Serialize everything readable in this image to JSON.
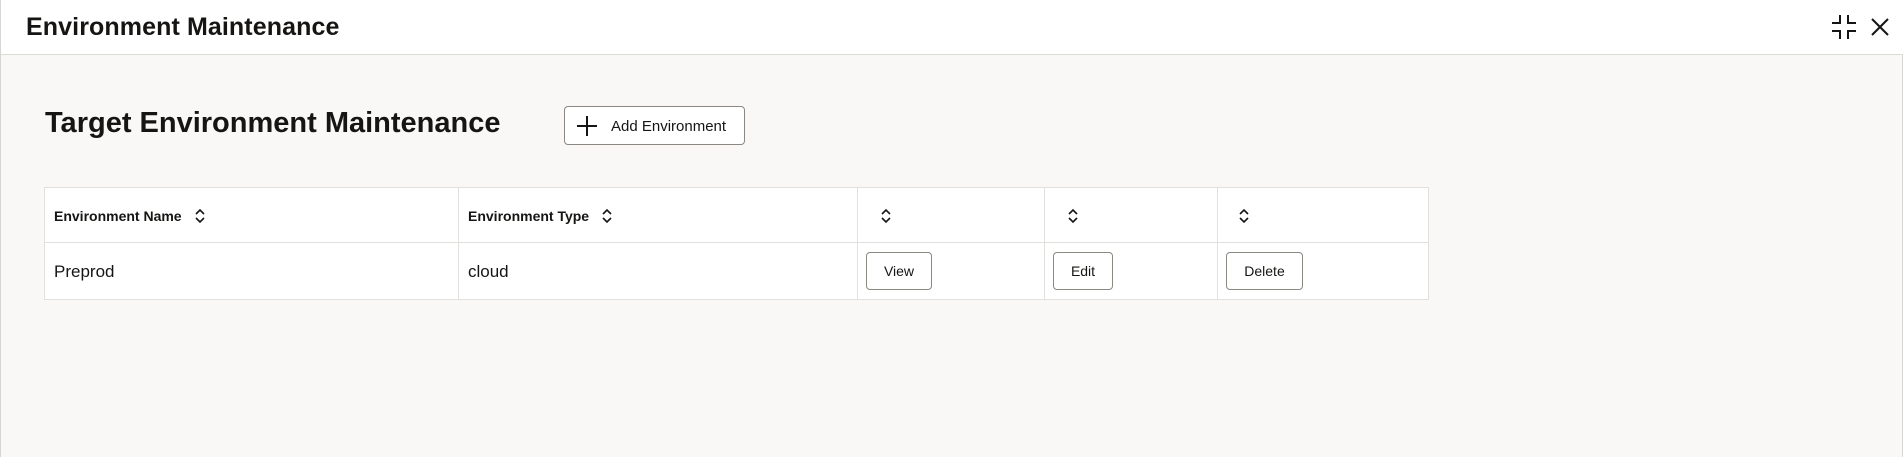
{
  "window": {
    "title": "Environment Maintenance",
    "collapse_icon": "collapse-icon",
    "close_icon": "close-icon"
  },
  "page": {
    "heading": "Target Environment Maintenance",
    "add_button_label": "Add Environment",
    "add_button_icon": "plus-icon"
  },
  "table": {
    "columns": [
      {
        "label": "Environment Name",
        "sortable": true
      },
      {
        "label": "Environment Type",
        "sortable": true
      },
      {
        "label": "",
        "sortable": true
      },
      {
        "label": "",
        "sortable": true
      },
      {
        "label": "",
        "sortable": true
      }
    ],
    "rows": [
      {
        "name": "Preprod",
        "type": "cloud",
        "view_label": "View",
        "edit_label": "Edit",
        "delete_label": "Delete"
      }
    ]
  },
  "colors": {
    "background": "#f9f8f6",
    "surface": "#ffffff",
    "text": "#161513",
    "border": "#8b8781"
  }
}
